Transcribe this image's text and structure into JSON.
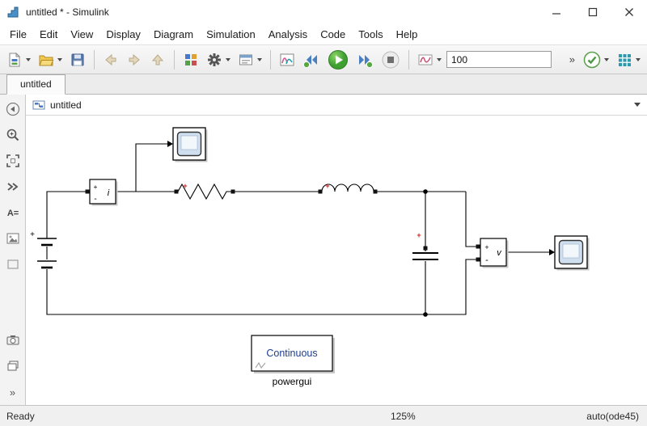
{
  "window": {
    "title": "untitled * - Simulink"
  },
  "menu": {
    "items": [
      "File",
      "Edit",
      "View",
      "Display",
      "Diagram",
      "Simulation",
      "Analysis",
      "Code",
      "Tools",
      "Help"
    ]
  },
  "toolbar": {
    "stop_time": "100",
    "overflow_glyph": "»"
  },
  "tabs": {
    "active_label": "untitled"
  },
  "breadcrumb": {
    "current": "untitled"
  },
  "palette": {
    "annotation_glyph": "A=",
    "overflow_glyph": "»"
  },
  "canvas": {
    "current_block": {
      "label": "i",
      "plus": "+",
      "minus": "-"
    },
    "voltage_block": {
      "label": "v",
      "plus": "+",
      "minus": "-"
    },
    "battery_plus": "+",
    "polarity_plus": "+",
    "powergui": {
      "mode": "Continuous",
      "name": "powergui"
    }
  },
  "status": {
    "state": "Ready",
    "zoom": "125%",
    "solver": "auto(ode45)"
  }
}
